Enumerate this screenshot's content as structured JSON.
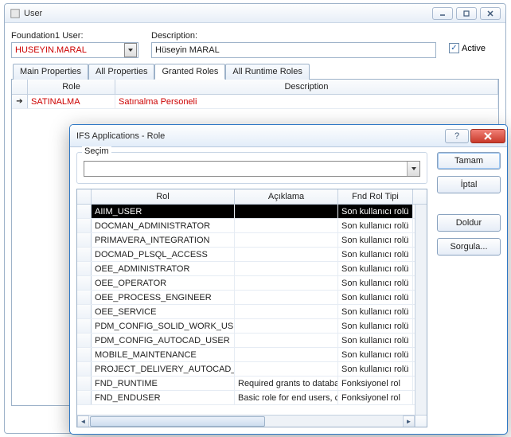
{
  "main_window": {
    "title": "User",
    "fields": {
      "user_label": "Foundation1 User:",
      "user_value": "HUSEYIN.MARAL",
      "desc_label": "Description:",
      "desc_value": "Hüseyin MARAL",
      "active_label": "Active"
    },
    "tabs": [
      "Main Properties",
      "All Properties",
      "Granted Roles",
      "All Runtime Roles"
    ],
    "active_tab": 2,
    "grid": {
      "headers": {
        "role": "Role",
        "desc": "Description"
      },
      "rows": [
        {
          "role": "SATINALMA",
          "desc": "Satınalma Personeli"
        }
      ]
    }
  },
  "dialog": {
    "title": "IFS Applications - Role",
    "secim_label": "Seçim",
    "buttons": {
      "ok": "Tamam",
      "cancel": "İptal",
      "fill": "Doldur",
      "query": "Sorgula..."
    },
    "grid": {
      "headers": {
        "rol": "Rol",
        "acik": "Açıklama",
        "tip": "Fnd Rol Tipi"
      },
      "selected": 0,
      "rows": [
        {
          "rol": "AIIM_USER",
          "acik": "",
          "tip": "Son kullanıcı rolü"
        },
        {
          "rol": "DOCMAN_ADMINISTRATOR",
          "acik": "",
          "tip": "Son kullanıcı rolü"
        },
        {
          "rol": "PRIMAVERA_INTEGRATION",
          "acik": "",
          "tip": "Son kullanıcı rolü"
        },
        {
          "rol": "DOCMAD_PLSQL_ACCESS",
          "acik": "",
          "tip": "Son kullanıcı rolü"
        },
        {
          "rol": "OEE_ADMINISTRATOR",
          "acik": "",
          "tip": "Son kullanıcı rolü"
        },
        {
          "rol": "OEE_OPERATOR",
          "acik": "",
          "tip": "Son kullanıcı rolü"
        },
        {
          "rol": "OEE_PROCESS_ENGINEER",
          "acik": "",
          "tip": "Son kullanıcı rolü"
        },
        {
          "rol": "OEE_SERVICE",
          "acik": "",
          "tip": "Son kullanıcı rolü"
        },
        {
          "rol": "PDM_CONFIG_SOLID_WORK_USE",
          "acik": "",
          "tip": "Son kullanıcı rolü"
        },
        {
          "rol": "PDM_CONFIG_AUTOCAD_USER",
          "acik": "",
          "tip": "Son kullanıcı rolü"
        },
        {
          "rol": "MOBILE_MAINTENANCE",
          "acik": "",
          "tip": "Son kullanıcı rolü"
        },
        {
          "rol": "PROJECT_DELIVERY_AUTOCAD_U",
          "acik": "",
          "tip": "Son kullanıcı rolü"
        },
        {
          "rol": "FND_RUNTIME",
          "acik": "Required grants to database ob",
          "tip": "Fonksiyonel rol"
        },
        {
          "rol": "FND_ENDUSER",
          "acik": "Basic role for end users, contai",
          "tip": "Fonksiyonel rol"
        }
      ]
    }
  }
}
